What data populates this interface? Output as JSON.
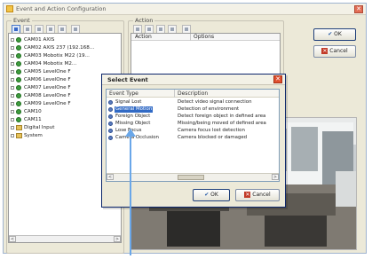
{
  "window": {
    "title": "Event and Action Configuration",
    "close_glyph": "✕"
  },
  "event_group": {
    "label": "Event",
    "tree": [
      {
        "label": "CAM01 AXIS",
        "kind": "camera"
      },
      {
        "label": "CAM02 AXIS 237 (192.168...",
        "kind": "camera"
      },
      {
        "label": "CAM03 Mobotix M22 (19...",
        "kind": "camera"
      },
      {
        "label": "CAM04 Mobotix M2...",
        "kind": "camera"
      },
      {
        "label": "CAM05 LevelOne F",
        "kind": "camera"
      },
      {
        "label": "CAM06 LevelOne F",
        "kind": "camera"
      },
      {
        "label": "CAM07 LevelOne F",
        "kind": "camera"
      },
      {
        "label": "CAM08 LevelOne F",
        "kind": "camera"
      },
      {
        "label": "CAM09 LevelOne F",
        "kind": "camera"
      },
      {
        "label": "CAM10",
        "kind": "camera"
      },
      {
        "label": "CAM11",
        "kind": "camera"
      },
      {
        "label": "Digital Input",
        "kind": "folder"
      },
      {
        "label": "System",
        "kind": "folder"
      }
    ],
    "scroll_left": "<",
    "scroll_right": ">"
  },
  "action_group": {
    "label": "Action",
    "columns": [
      "Action",
      "Options"
    ]
  },
  "buttons": {
    "ok_label": "OK",
    "cancel_label": "Cancel",
    "check_glyph": "✔",
    "x_glyph": "✕"
  },
  "select_event": {
    "title": "Select Event",
    "columns": [
      "Event Type",
      "Description"
    ],
    "rows": [
      {
        "type": "Signal Lost",
        "description": "Detect video signal connection",
        "selected": false
      },
      {
        "type": "General Motion",
        "description": "Detection of environment",
        "selected": true
      },
      {
        "type": "Foreign Object",
        "description": "Detect foreign object in defined area",
        "selected": false
      },
      {
        "type": "Missing Object",
        "description": "Missing/being moved of defined area",
        "selected": false
      },
      {
        "type": "Lose Focus",
        "description": "Camera focus lost detection",
        "selected": false
      },
      {
        "type": "Camera Occlusion",
        "description": "Camera blocked or damaged",
        "selected": false
      }
    ],
    "scroll_left": "<",
    "scroll_right": ">",
    "ok_label": "OK",
    "cancel_label": "Cancel"
  },
  "colors": {
    "accent": "#316ac5",
    "window_bg": "#ece9d8",
    "annotation_arrow": "#6aa7e9"
  }
}
